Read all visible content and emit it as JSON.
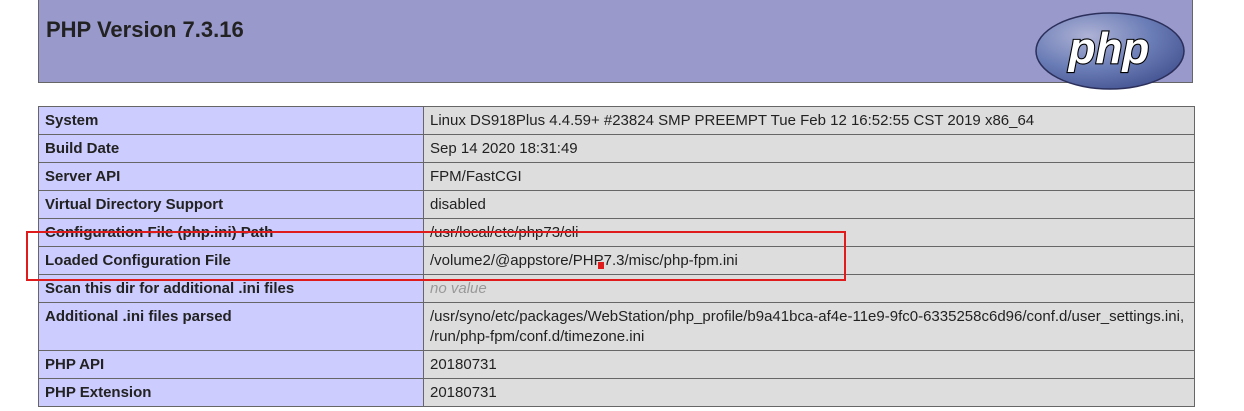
{
  "header": {
    "title": "PHP Version 7.3.16",
    "logo_text": "php",
    "logo_icon": "php-logo-icon"
  },
  "rows": [
    {
      "label": "System",
      "value": "Linux DS918Plus 4.4.59+ #23824 SMP PREEMPT Tue Feb 12 16:52:55 CST 2019 x86_64",
      "italic": false
    },
    {
      "label": "Build Date",
      "value": "Sep 14 2020 18:31:49",
      "italic": false
    },
    {
      "label": "Server API",
      "value": "FPM/FastCGI",
      "italic": false
    },
    {
      "label": "Virtual Directory Support",
      "value": "disabled",
      "italic": false
    },
    {
      "label": "Configuration File (php.ini) Path",
      "value": "/usr/local/etc/php73/cli",
      "italic": false
    },
    {
      "label": "Loaded Configuration File",
      "value": "/volume2/@appstore/PHP7.3/misc/php-fpm.ini",
      "italic": false
    },
    {
      "label": "Scan this dir for additional .ini files",
      "value": "no value",
      "italic": true
    },
    {
      "label": "Additional .ini files parsed",
      "value": "/usr/syno/etc/packages/WebStation/php_profile/b9a41bca-af4e-11e9-9fc0-6335258c6d96/conf.d/user_settings.ini, /run/php-fpm/conf.d/timezone.ini",
      "italic": false
    },
    {
      "label": "PHP API",
      "value": "20180731",
      "italic": false
    },
    {
      "label": "PHP Extension",
      "value": "20180731",
      "italic": false
    }
  ],
  "colors": {
    "header_bg": "#9999cc",
    "label_bg": "#ccccff",
    "value_bg": "#dddddd",
    "highlight": "#e01b1b"
  }
}
